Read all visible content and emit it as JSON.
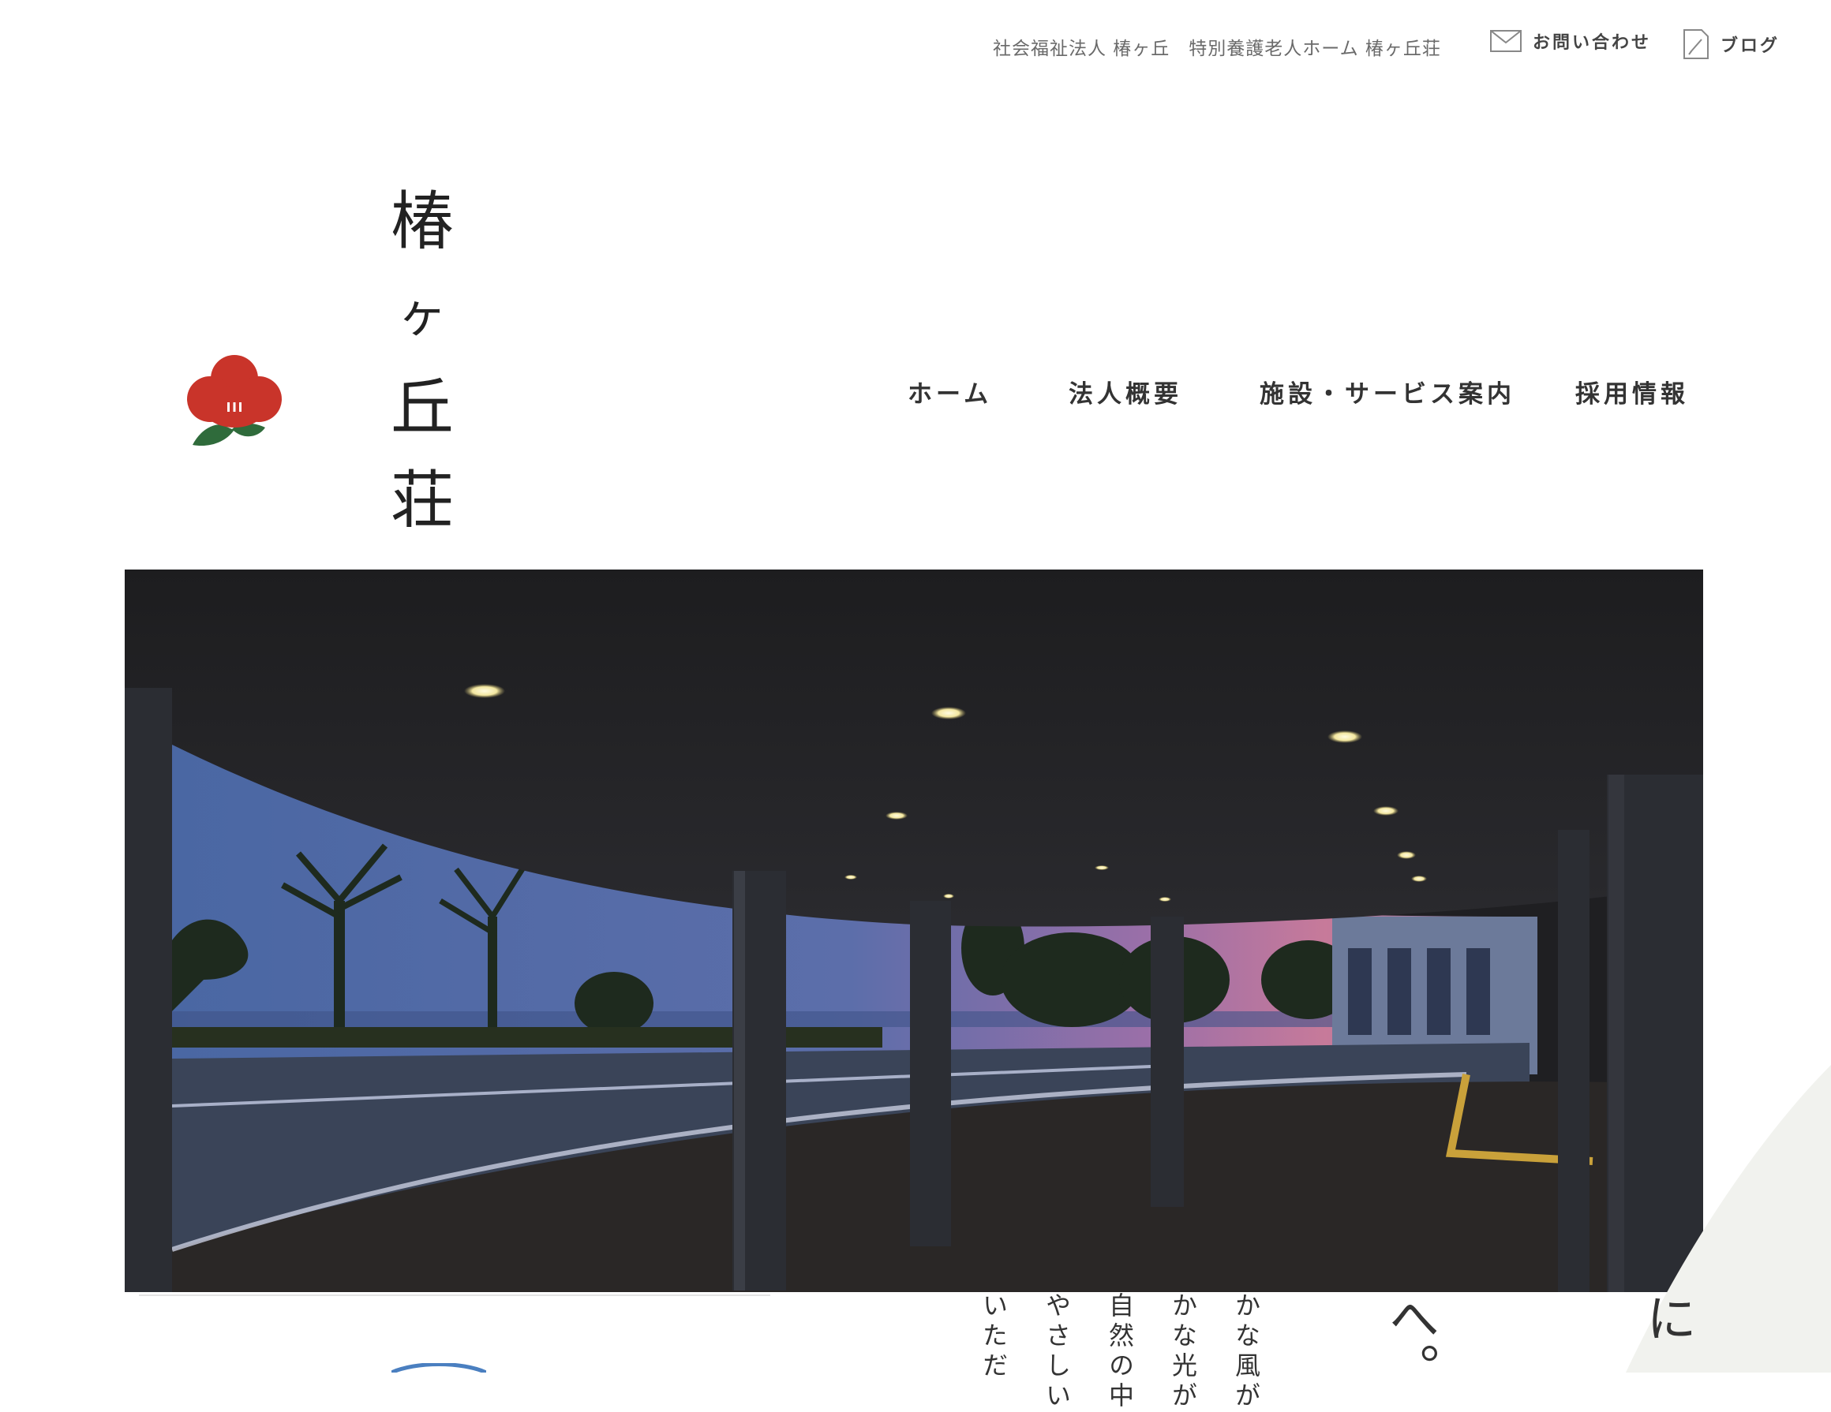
{
  "header": {
    "org_name": "社会福祉法人 椿ヶ丘　特別養護老人ホーム 椿ヶ丘荘",
    "contact_label": "お問い合わせ",
    "blog_label": "ブログ",
    "contact_icon": "mail-icon",
    "blog_icon": "pen-note-icon"
  },
  "logo": {
    "icon": "camellia-logo-icon",
    "chars": [
      "椿",
      "ヶ",
      "丘",
      "荘"
    ]
  },
  "nav": {
    "items": [
      {
        "label": "ホーム"
      },
      {
        "label": "法人概要"
      },
      {
        "label": "施設・サービス案内"
      },
      {
        "label": "採用情報"
      }
    ]
  },
  "hero": {
    "image": "night-view-building-entrance-canopy"
  },
  "intro": {
    "col1": "かな風が",
    "col2": "かな光が",
    "col3": "自然の中",
    "col4": "やさしい",
    "col5": "いただ",
    "big1": "へ。",
    "big2": "に"
  },
  "colors": {
    "brand_red": "#c9342a",
    "leaf_green": "#2f6b3b",
    "text_dark": "#333333",
    "text_gray": "#6a6a6a"
  }
}
